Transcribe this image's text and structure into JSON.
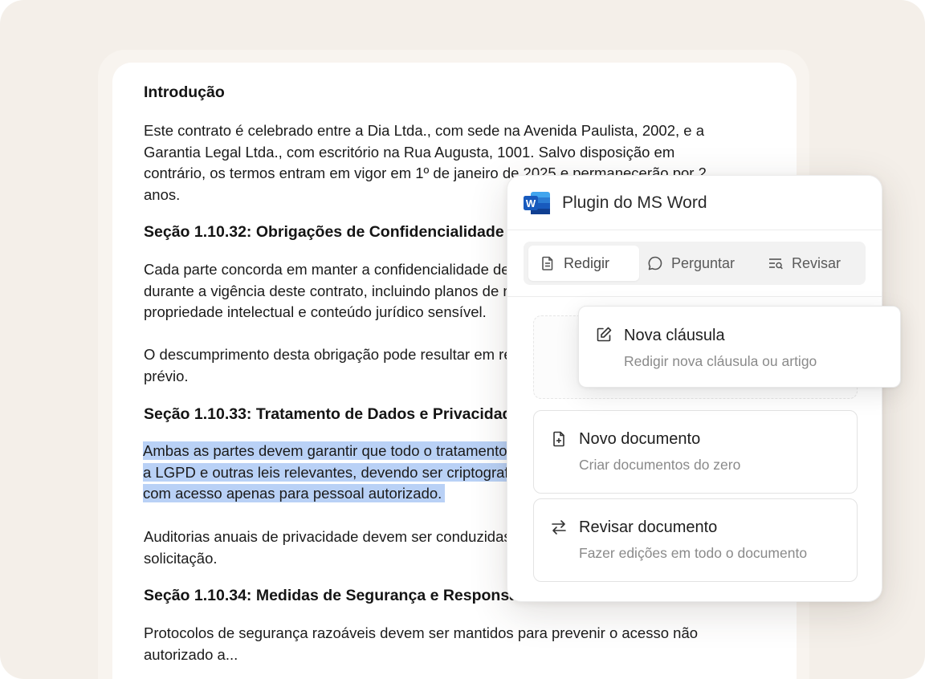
{
  "document": {
    "heading_intro": "Introdução",
    "para_intro_lines": [
      "Este contrato é celebrado entre a Dia Ltda., com sede na Avenida Paulista, 2002, e a",
      "Garantia Legal Ltda., com escritório na Rua Augusta, 1001. Salvo disposição em",
      "contrário, os termos entram em vigor em 1º de janeiro de 2025 e permanecerão por 2",
      "anos."
    ],
    "section_1": "Seção 1.10.32: Obrigações de Confidencialidade",
    "section_1_para_lines": [
      "Cada parte concorda em manter a confidencialidade de todas as informações trocadas",
      "durante a vigência deste contrato, incluindo planos de negócios, dados de clientes,",
      "propriedade intelectual e conteúdo jurídico sensível."
    ],
    "section_1_para2_lines": [
      "O descumprimento desta obrigação pode resultar em rescisão imediata sem aviso",
      "prévio."
    ],
    "section_2": "Seção 1.10.33: Tratamento de Dados e Privacidade",
    "section_2_highlight_lines": [
      "Ambas as partes devem garantir que todo o tratamento de dados pessoais esteja conforme",
      "a LGPD e outras leis relevantes, devendo ser criptografados e armazenados com segurança,",
      "com acesso apenas para pessoal autorizado."
    ],
    "section_2_para2_lines": [
      "Auditorias anuais de privacidade devem ser conduzidas e disponibilizadas mediante",
      "solicitação."
    ],
    "section_3": "Seção 1.10.34: Medidas de Segurança e Responsabilidade",
    "section_3_para_lines": [
      "Protocolos de segurança razoáveis devem ser mantidos para prevenir o acesso não",
      "autorizado a..."
    ]
  },
  "plugin": {
    "title": "Plugin do MS Word",
    "logo_letter": "W",
    "tabs": [
      {
        "label": "Redigir",
        "icon": "document-icon",
        "active": true
      },
      {
        "label": "Perguntar",
        "icon": "chat-bubble-icon",
        "active": false
      },
      {
        "label": "Revisar",
        "icon": "review-lines-icon",
        "active": false
      }
    ],
    "options": [
      {
        "title": "Nova cláusula",
        "subtitle": "Redigir nova cláusula ou artigo",
        "icon": "edit-icon"
      },
      {
        "title": "Novo documento",
        "subtitle": "Criar documentos do zero",
        "icon": "new-file-icon"
      },
      {
        "title": "Revisar documento",
        "subtitle": "Fazer edições em todo o documento",
        "icon": "swap-arrows-icon"
      }
    ]
  },
  "colors": {
    "background": "#f4efe9",
    "highlight": "#b9d1f6",
    "word_blue": "#185abd"
  }
}
